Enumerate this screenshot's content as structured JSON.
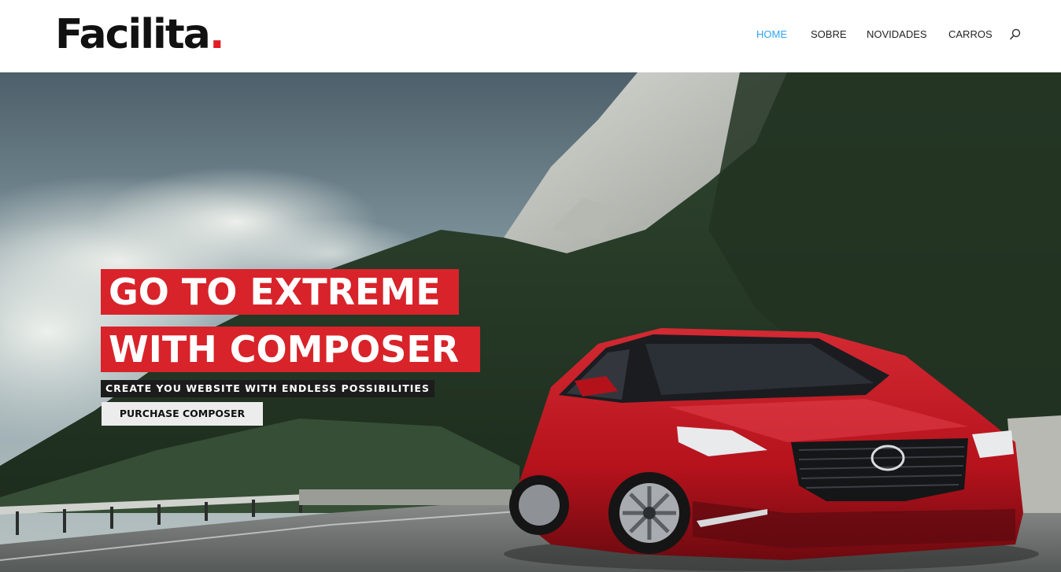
{
  "header": {
    "logo_text": "Facilita",
    "logo_dot": ".",
    "nav": {
      "items": [
        {
          "label": "HOME",
          "active": true
        },
        {
          "label": "SOBRE",
          "active": false
        },
        {
          "label": "NOVIDADES",
          "active": false
        },
        {
          "label": "CARROS",
          "active": false
        }
      ],
      "search_icon": "search-icon"
    }
  },
  "hero": {
    "headline_1": "GO TO EXTREME",
    "headline_2": "WITH COMPOSER",
    "subheadline": "CREATE YOU WEBSITE WITH ENDLESS POSSIBILITIES",
    "cta_label": "PURCHASE COMPOSER",
    "background": "mountain-road-red-car-photo"
  },
  "colors": {
    "accent_red": "#d8232a",
    "logo_dot_red": "#e21b24",
    "nav_active": "#2ea3f2",
    "text_dark": "#222222",
    "subline_bg": "#1c1c1c",
    "cta_bg": "#ececec"
  }
}
